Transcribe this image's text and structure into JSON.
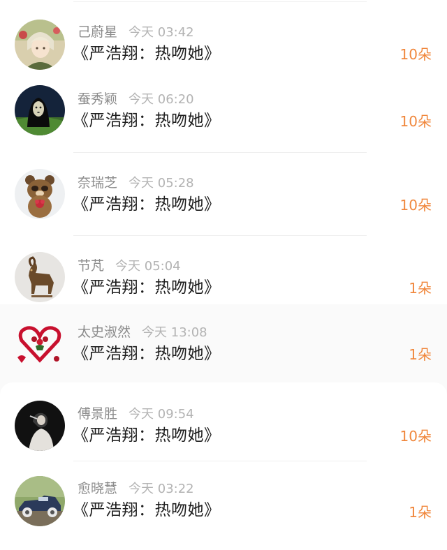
{
  "gifts": [
    {
      "name": "己蔚星",
      "time": "今天 03:42",
      "title": "《严浩翔：热吻她》",
      "count": "10朵",
      "avatar": "anime-boy-avatar"
    },
    {
      "name": "蚕秀颖",
      "time": "今天 06:20",
      "title": "《严浩翔：热吻她》",
      "count": "10朵",
      "avatar": "masked-figure-avatar"
    },
    {
      "name": "奈瑞芝",
      "time": "今天 05:28",
      "title": "《严浩翔：热吻她》",
      "count": "10朵",
      "avatar": "raccoon-plush-avatar"
    },
    {
      "name": "节芃",
      "time": "今天 05:04",
      "title": "《严浩翔：热吻她》",
      "count": "1朵",
      "avatar": "bronze-goat-avatar"
    },
    {
      "name": "太史淑然",
      "time": "今天 13:08",
      "title": "《严浩翔：热吻她》",
      "count": "1朵",
      "avatar": "rose-heart-avatar"
    },
    {
      "name": "傅景胜",
      "time": "今天 09:54",
      "title": "《严浩翔：热吻她》",
      "count": "10朵",
      "avatar": "girl-photo-avatar"
    },
    {
      "name": "愈晓慧",
      "time": "今天 03:22",
      "title": "《严浩翔：热吻她》",
      "count": "1朵",
      "avatar": "vintage-car-avatar"
    }
  ],
  "colors": {
    "count": "#f0873c",
    "name": "#8c8c8c",
    "time": "#b3b3b3",
    "title": "#1e1e1e"
  }
}
